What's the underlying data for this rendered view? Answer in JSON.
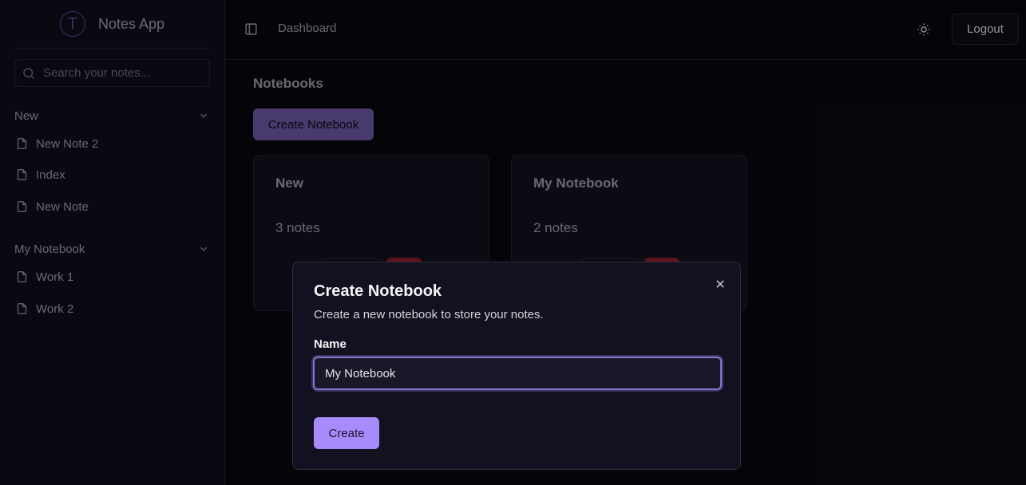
{
  "sidebar": {
    "logo_letter": "T",
    "app_title": "Notes App",
    "search_placeholder": "Search your notes...",
    "notebooks": [
      {
        "name": "New",
        "notes": [
          "New Note 2",
          "Index",
          "New Note"
        ]
      },
      {
        "name": "My Notebook",
        "notes": [
          "Work 1",
          "Work 2"
        ]
      }
    ]
  },
  "topbar": {
    "breadcrumb": "Dashboard",
    "logout_label": "Logout"
  },
  "main": {
    "section_title": "Notebooks",
    "create_button": "Create Notebook",
    "cards": [
      {
        "title": "New",
        "count": "3 notes"
      },
      {
        "title": "My Notebook",
        "count": "2 notes"
      }
    ]
  },
  "dialog": {
    "title": "Create Notebook",
    "description": "Create a new notebook to store your notes.",
    "name_label": "Name",
    "name_value": "My Notebook",
    "submit_label": "Create"
  },
  "colors": {
    "accent": "#a78bfa",
    "accent_muted": "#6f5aa8",
    "danger": "#8f1d2c",
    "background": "#09080f"
  }
}
